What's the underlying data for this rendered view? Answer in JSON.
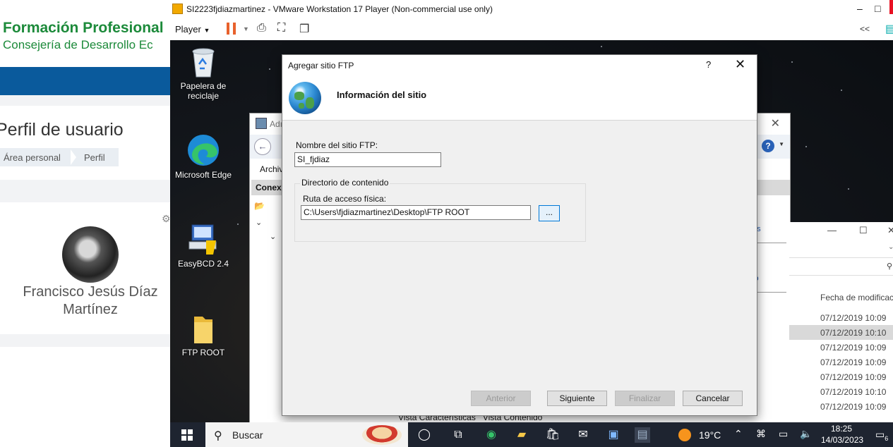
{
  "left_page": {
    "brand_line1": "Formación Profesional",
    "brand_line2": "Consejería de Desarrollo Ec",
    "title": "Perfil de usuario",
    "breadcrumb": [
      "Área personal",
      "Perfil"
    ],
    "user_name": "Francisco Jesús Díaz Martínez",
    "gear_icon": "gear-icon"
  },
  "vmware": {
    "title": "SI2223fjdiazmartinez - VMware Workstation 17 Player (Non-commercial use only)",
    "player_menu": "Player",
    "minimize": "–",
    "maximize": "□",
    "collapse": "<<",
    "accent": "#e8612c"
  },
  "desktop": {
    "icons": [
      {
        "label": "Papelera de reciclaje",
        "icon": "recycle-bin-icon"
      },
      {
        "label": "Microsoft Edge",
        "icon": "edge-icon"
      },
      {
        "label": "EasyBCD 2.4",
        "icon": "easybcd-icon"
      },
      {
        "label": "FTP ROOT",
        "icon": "folder-icon"
      }
    ]
  },
  "iis_window": {
    "title_partial": "Adı",
    "menu_partial": "Archiv",
    "connections_partial": "Conexi",
    "link1_partial": "os",
    "link2_partial": "io",
    "status_tabs": [
      "Vista Características",
      "Vista Contenido"
    ]
  },
  "explorer": {
    "column_header": "Fecha de modificac",
    "dates": [
      "07/12/2019 10:09",
      "07/12/2019 10:10",
      "07/12/2019 10:09",
      "07/12/2019 10:09",
      "07/12/2019 10:09",
      "07/12/2019 10:10",
      "07/12/2019 10:09"
    ],
    "selected_row": 1
  },
  "dialog": {
    "title": "Agregar sitio FTP",
    "help": "?",
    "close": "✕",
    "heading": "Información del sitio",
    "site_name_label": "Nombre del sitio FTP:",
    "site_name_value": "SI_fjdiaz",
    "content_dir_label": "Directorio de contenido",
    "path_label": "Ruta de acceso física:",
    "path_value": "C:\\Users\\fjdiazmartinez\\Desktop\\FTP ROOT",
    "browse_label": "...",
    "buttons": {
      "previous": "Anterior",
      "next": "Siguiente",
      "finish": "Finalizar",
      "cancel": "Cancelar"
    }
  },
  "taskbar": {
    "search_placeholder": "Buscar",
    "temperature": "19°C",
    "time": "18:25",
    "date": "14/03/2023",
    "notification_count": "6"
  }
}
